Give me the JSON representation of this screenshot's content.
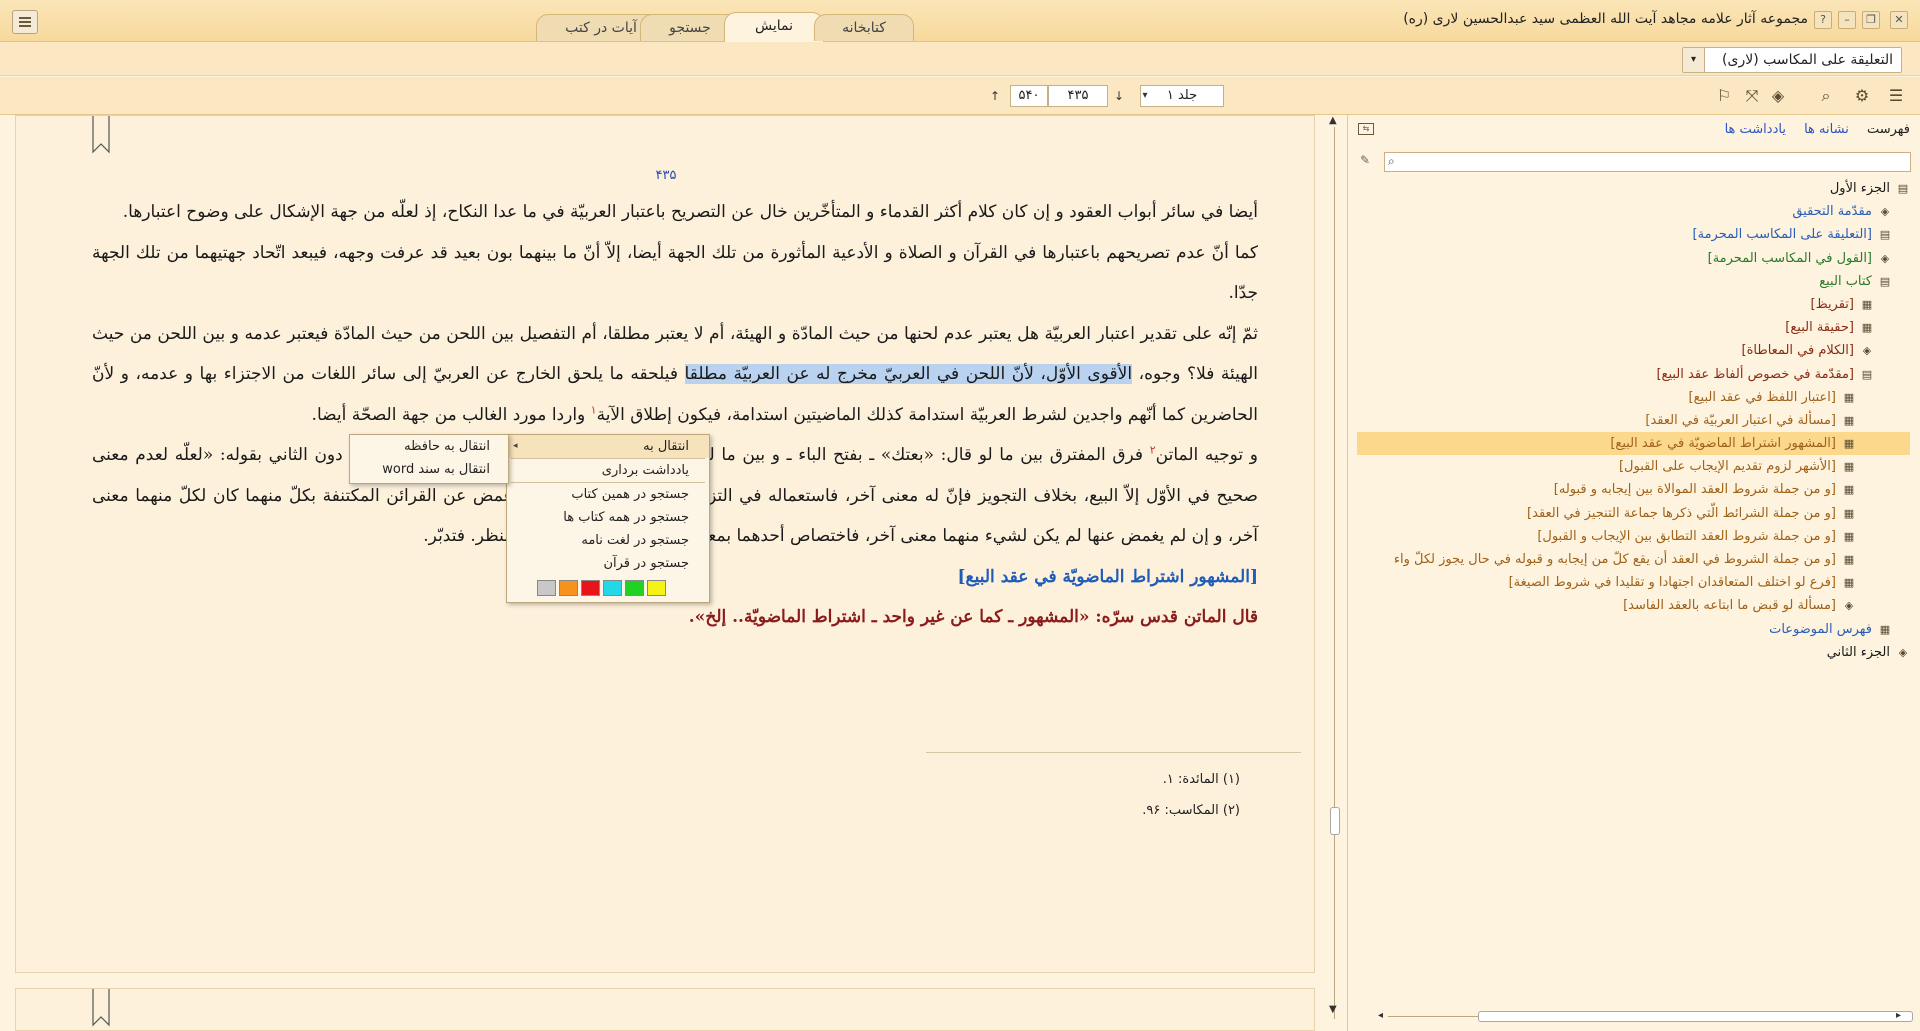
{
  "window": {
    "title": "مجموعه آثار علامه مجاهد آیت الله العظمی سید عبدالحسین لاری (ره)",
    "help": "?",
    "minimize": "–",
    "restore": "❐",
    "close": "✕"
  },
  "tabs": [
    {
      "label": "کتابخانه"
    },
    {
      "label": "نمایش"
    },
    {
      "label": "جستجو"
    },
    {
      "label": "آیات در کتب"
    }
  ],
  "book_selector": {
    "value": "التعلیقة علی المکاسب (لاری)",
    "arrow": "▾"
  },
  "toolbar": {
    "volume": "جلد ۱",
    "volume_arrow": "▾",
    "page": "۴۳۵",
    "total_pages": "۵۴۰",
    "down_arrow": "↓",
    "up_arrow": "↑",
    "icons": {
      "toc": "☰",
      "settings": "⚙",
      "search": "⌕",
      "layers": "◈",
      "fullscreen": "⤧",
      "bookmark": "⚐"
    }
  },
  "document": {
    "page_number": "۴۳۵",
    "paragraphs": {
      "p1": "أیضا في سائر أبواب العقود و إن کان کلام أکثر القدماء و المتأخّرین خال عن التصریح باعتبار العربیّة في ما عدا النکاح، إذ لعلّه من جهة الإشکال علی وضوح اعتبارها.",
      "p2": "کما أنّ عدم تصریحهم باعتبارها في القرآن و الصلاة و الأدعیة المأثورة من تلك الجهة أیضا، إلاّ أنّ ما بینهما بون بعید قد عرفت وجهه، فیبعد اتّحاد جهتیهما من تلك الجهة جدّا.",
      "p3a": "ثمّ إنّه علی تقدیر اعتبار العربیّة هل یعتبر عدم لحنها من حیث المادّة و الهیئة، أم لا یعتبر مطلقا، أم التفصیل بین اللحن من حیث المادّة فیعتبر عدمه و بین اللحن من حیث الهیئة فلا؟ وجوه، ",
      "p3hl": "الأقوی الأوّل، لأنّ اللحن في العربيّ مخرج له عن العربیّة مطلقا",
      "p3b": " فیلحقه ما یلحق الخارج عن العربيّ إلی سائر اللغات من الاجتزاء بها و عدمه، و لأنّ الحاضرین کما أنّهم واجدین لشرط العربیّة استدامة کذلك الماضیتین استدامة، فیکون إطلاق الآیة",
      "p3sup": "۱",
      "p3c": " واردا مورد الغالب من جهة الصحّة أیضا.",
      "p4a": "و توجیه الماتن",
      "p4sup": "۲",
      "p4b": " فرق المفترق بین ما لو قال: «بعتك» ـ بفتح الباء ـ و بین ما لو قال: «جوّزتك» بدل «زوّجتك» في تصحیحه الأوّل دون الثاني بقوله: «لعلّه لعدم معنی صحیح في الأوّل إلاّ البیع، بخلاف التجویز فإنّ له معنی آخر، فاستعماله في التزویج غیر جائز» فیه: أنّه إن أغمض عن القرائن المکتنفة بکلّ منهما کان لکلّ منهما معنی آخر، و إن لم یغمض عنها لم یکن لشيء منهما معنی آخر، فاختصاص أحدهما بمعنی آخر دون الآخر في محلّ النظر. فتدبّر.",
      "heading": "[المشهور اشتراط الماضویّة في عقد البیع]",
      "quote": "قال الماتن قدس سرّه: «المشهور ـ کما عن غیر واحد ـ اشتراط الماضویّة.. إلخ»."
    },
    "footnotes": [
      "(۱) المائدة: ۱.",
      "(۲) المکاسب: ۹۶."
    ]
  },
  "context_menu": {
    "items": [
      {
        "label": "انتقال به",
        "submenu": true,
        "arrow": "◂"
      },
      {
        "label": "یادداشت برداری"
      },
      {
        "label": "جستجو در همین کتاب"
      },
      {
        "label": "جستجو در همه کتاب ها"
      },
      {
        "label": "جستجو در لغت نامه"
      },
      {
        "label": "جستجو در قرآن"
      }
    ],
    "highlight_colors": [
      "#c8c8c8",
      "#f7921e",
      "#e8141c",
      "#20d8e8",
      "#21d321",
      "#f3f317"
    ],
    "submenu": [
      {
        "label": "انتقال به حافظه"
      },
      {
        "label": "انتقال به سند word"
      }
    ]
  },
  "panel": {
    "tabs": {
      "toc": "فهرست",
      "bookmarks": "نشانه ها",
      "notes": "یادداشت ها"
    },
    "search_placeholder": "",
    "tree": [
      {
        "label": "الجزء الأول",
        "indent": 0,
        "color": "black",
        "icon": "book"
      },
      {
        "label": "مقدّمة التحقیق",
        "indent": 1,
        "color": "blue",
        "icon": "section"
      },
      {
        "label": "[التعلیقة علی المکاسب المحرمة]",
        "indent": 1,
        "color": "blue",
        "icon": "book"
      },
      {
        "label": "[القول في المکاسب المحرمة]",
        "indent": 1,
        "color": "green",
        "icon": "section"
      },
      {
        "label": "کتاب البیع",
        "indent": 1,
        "color": "green",
        "icon": "book"
      },
      {
        "label": "[تقریظ]",
        "indent": 2,
        "color": "brown",
        "icon": "page"
      },
      {
        "label": "[حقیقة البیع]",
        "indent": 2,
        "color": "brown",
        "icon": "page"
      },
      {
        "label": "[الکلام في المعاطاة]",
        "indent": 2,
        "color": "brown",
        "icon": "section"
      },
      {
        "label": "[مقدّمة في خصوص ألفاظ عقد البیع]",
        "indent": 2,
        "color": "brown",
        "icon": "book"
      },
      {
        "label": "[اعتبار اللفظ في عقد البیع]",
        "indent": 3,
        "color": "olive",
        "icon": "page"
      },
      {
        "label": "[مسألة في اعتبار العربیّة في العقد]",
        "indent": 3,
        "color": "olive",
        "icon": "page"
      },
      {
        "label": "[المشهور اشتراط الماضویّة في عقد البیع]",
        "indent": 3,
        "color": "olive",
        "icon": "page",
        "selected": true
      },
      {
        "label": "[الأشهر لزوم تقدیم الإیجاب علی القبول]",
        "indent": 3,
        "color": "olive",
        "icon": "page"
      },
      {
        "label": "[و من جملة شروط العقد الموالاة بین إیجابه و قبوله]",
        "indent": 3,
        "color": "olive",
        "icon": "page"
      },
      {
        "label": "[و من جملة الشرائط الّتي ذکرها جماعة التنجیز في العقد]",
        "indent": 3,
        "color": "olive",
        "icon": "page"
      },
      {
        "label": "[و من جملة شروط العقد التطابق بین الإیجاب و القبول]",
        "indent": 3,
        "color": "olive",
        "icon": "page"
      },
      {
        "label": "[و من جملة الشروط في العقد أن یقع کلّ من إیجابه و قبوله في حال یجوز لکلّ واء",
        "indent": 3,
        "color": "olive",
        "icon": "page"
      },
      {
        "label": "[فرع لو اختلف المتعاقدان اجتهادا و تقلیدا في شروط الصیغة]",
        "indent": 3,
        "color": "olive",
        "icon": "page"
      },
      {
        "label": "[مسألة لو قبض ما ابتاعه بالعقد الفاسد]",
        "indent": 3,
        "color": "olive",
        "icon": "section"
      },
      {
        "label": "فهرس الموضوعات",
        "indent": 1,
        "color": "blue",
        "icon": "page"
      },
      {
        "label": "الجزء الثاني",
        "indent": 0,
        "color": "black",
        "icon": "section"
      }
    ]
  }
}
